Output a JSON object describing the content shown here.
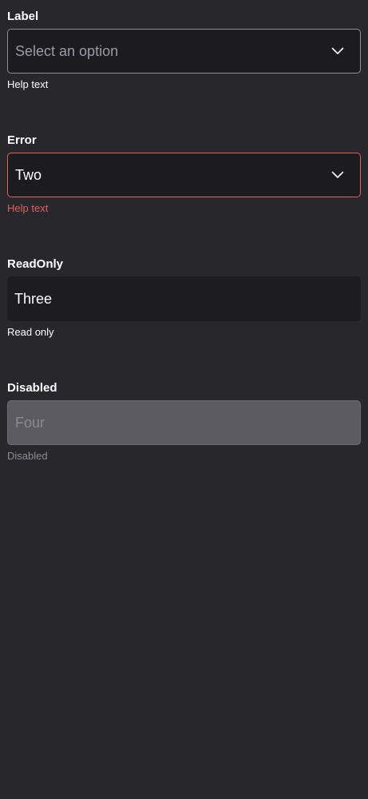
{
  "fields": [
    {
      "label": "Label",
      "placeholder": "Select an option",
      "help": "Help text",
      "icon": "chevron-down-icon"
    },
    {
      "label": "Error",
      "value": "Two",
      "help": "Help text",
      "icon": "chevron-down-icon"
    },
    {
      "label": "ReadOnly",
      "value": "Three",
      "help": "Read only"
    },
    {
      "label": "Disabled",
      "value": "Four",
      "help": "Disabled"
    }
  ],
  "colors": {
    "background": "#28272c",
    "field_background": "#1c1b20",
    "default_border": "#8e8d95",
    "error": "#e0605c",
    "disabled_background": "#5c5b63",
    "text": "#ffffff"
  }
}
